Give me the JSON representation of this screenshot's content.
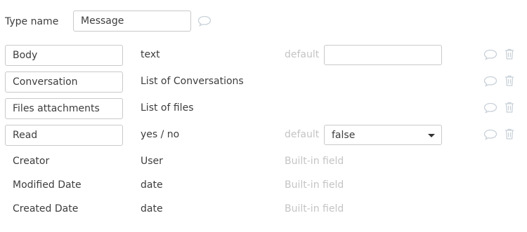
{
  "type_name": {
    "label": "Type name",
    "value": "Message"
  },
  "fields": [
    {
      "name": "Body",
      "type": "text",
      "default_label": "default",
      "default_value": "",
      "default_kind": "input"
    },
    {
      "name": "Conversation",
      "type": "List of Conversations"
    },
    {
      "name": "Files attachments",
      "type": "List of files"
    },
    {
      "name": "Read",
      "type": "yes / no",
      "default_label": "default",
      "default_value": "false",
      "default_kind": "select"
    }
  ],
  "builtin_fields": [
    {
      "name": "Creator",
      "type": "User",
      "note": "Built-in field"
    },
    {
      "name": "Modified Date",
      "type": "date",
      "note": "Built-in field"
    },
    {
      "name": "Created Date",
      "type": "date",
      "note": "Built-in field"
    }
  ],
  "colors": {
    "text": "#3d3d3d",
    "muted": "#c4c4c4",
    "border": "#c9c9c9",
    "icon": "#c8d0d8"
  },
  "icons": {
    "comment": "comment-bubble-icon",
    "delete": "trash-icon",
    "dropdown": "caret-down-icon"
  }
}
